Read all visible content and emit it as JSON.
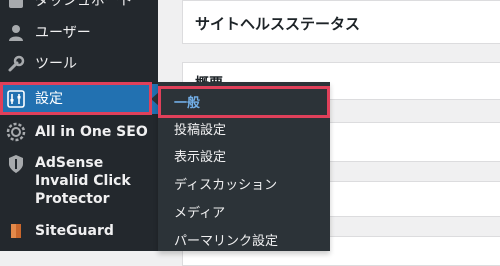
{
  "sidebar": {
    "partial_label": "ダッシュボード",
    "items": [
      {
        "label": "ユーザー",
        "icon": "user-icon"
      },
      {
        "label": "ツール",
        "icon": "wrench-icon"
      },
      {
        "label": "設定",
        "icon": "settings-icon"
      },
      {
        "label": "All in One SEO",
        "icon": "gear-icon"
      },
      {
        "label": "AdSense Invalid Click Protector",
        "icon": "shield-icon"
      },
      {
        "label": "SiteGuard",
        "icon": "siteguard-icon"
      }
    ]
  },
  "submenu": {
    "items": [
      {
        "label": "一般"
      },
      {
        "label": "投稿設定"
      },
      {
        "label": "表示設定"
      },
      {
        "label": "ディスカッション"
      },
      {
        "label": "メディア"
      },
      {
        "label": "パーマリンク設定"
      }
    ]
  },
  "main": {
    "health_title": "サイトヘルスステータス",
    "overview_title": "概要"
  },
  "colors": {
    "sidebar_bg": "#23282d",
    "active_bg": "#2271b1",
    "submenu_bg": "#2c3338",
    "highlight": "#e0405a",
    "current_link": "#72aee6"
  }
}
